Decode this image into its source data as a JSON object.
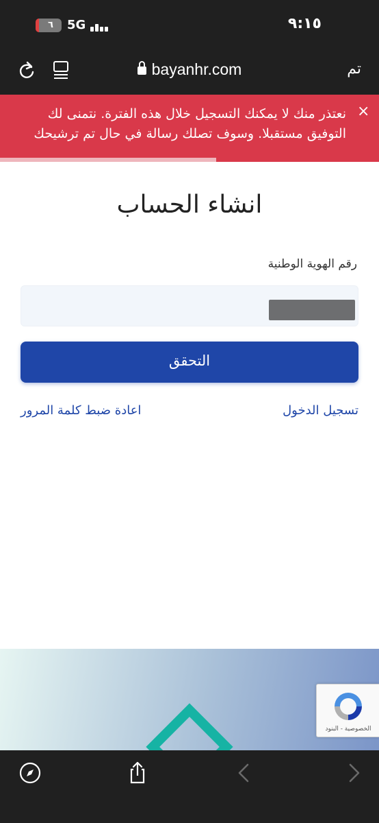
{
  "status_bar": {
    "time": "٩:١٥",
    "battery_level": "٦",
    "network": "5G"
  },
  "browser": {
    "done_label": "تم",
    "url": "bayanhr.com",
    "icons": [
      "reload-icon",
      "reader-mode-icon",
      "lock-icon"
    ]
  },
  "alert": {
    "message": "نعتذر منك لا يمكنك التسجيل خلال هذه الفترة. نتمنى لك التوفيق مستقبلا. وسوف تصلك رسالة في حال تم ترشيحك",
    "close_glyph": "×",
    "progress": 0.57,
    "background": "#d9394a"
  },
  "form": {
    "title": "انشاء الحساب",
    "id_label": "رقم الهوية الوطنية",
    "id_value": "",
    "verify_button": "التحقق",
    "accent": "#1f46a8"
  },
  "links": {
    "login": "تسجيل الدخول",
    "reset_password": "اعادة ضبط كلمة المرور"
  },
  "recaptcha": {
    "text": "الخصوصية - البنود"
  },
  "bottom_bar": {
    "icons": [
      "compass-icon",
      "share-icon",
      "back-arrow-icon",
      "forward-arrow-icon"
    ]
  }
}
